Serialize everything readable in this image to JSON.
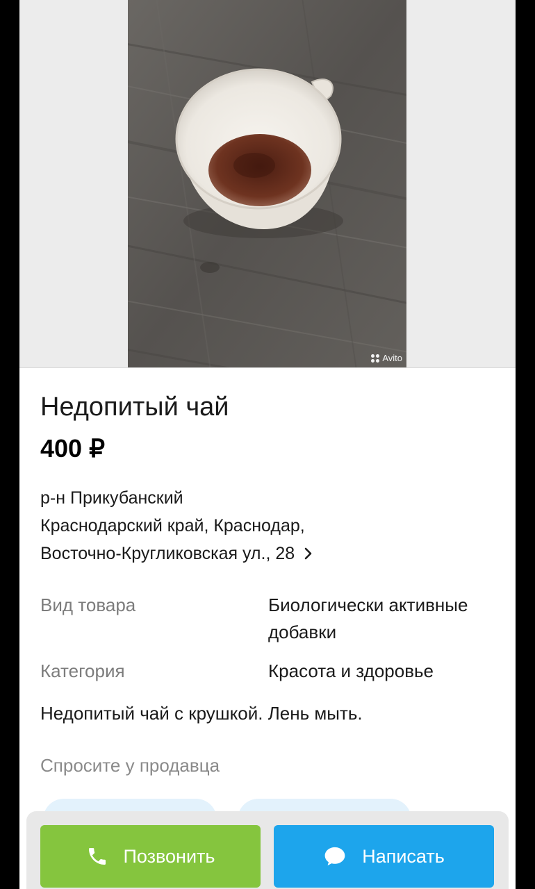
{
  "gallery": {
    "watermark": "Avito"
  },
  "listing": {
    "title": "Недопитый чай",
    "price": "400 ₽",
    "district": "р-н Прикубанский",
    "address_line1": "Краснодарский край, Краснодар,",
    "address_line2": "Восточно-Кругликовская ул., 28",
    "params": [
      {
        "label": "Вид товара",
        "value": "Биологически активные добавки"
      },
      {
        "label": "Категория",
        "value": "Красота и здоровье"
      }
    ],
    "description": "Недопитый чай с крушкой. Лень мыть.",
    "ask_seller": "Спросите у продавца"
  },
  "actions": {
    "call_label": "Позвонить",
    "write_label": "Написать",
    "call_icon": "phone-icon",
    "write_icon": "chat-bubble-icon",
    "call_color": "#85c53e",
    "write_color": "#1da5ec"
  }
}
